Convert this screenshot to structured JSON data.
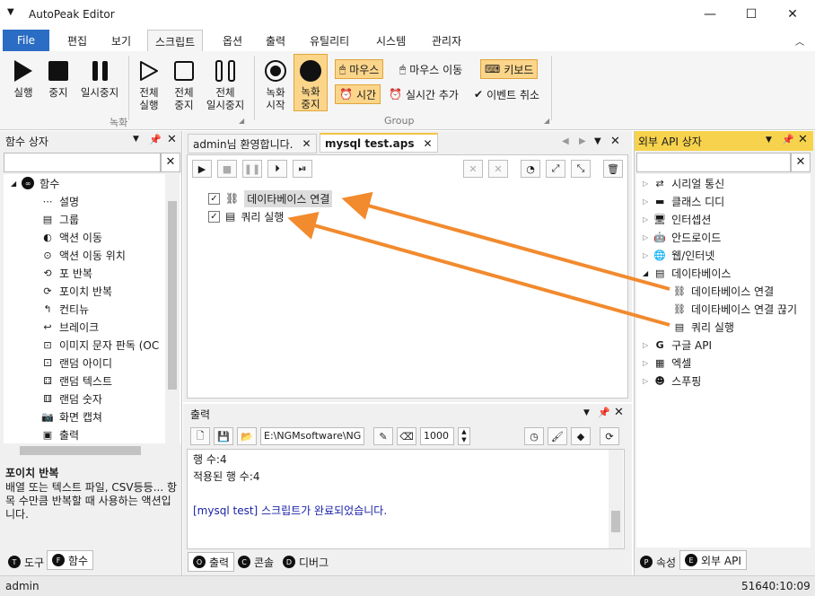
{
  "window": {
    "title": "AutoPeak Editor",
    "min": "—",
    "max": "☐",
    "close": "✕"
  },
  "menu": {
    "file": "File",
    "tabs": [
      "편집",
      "보기",
      "스크립트",
      "옵션",
      "출력",
      "유틸리티",
      "시스템",
      "관리자"
    ]
  },
  "ribbon": {
    "run": "실행",
    "stop": "중지",
    "pause": "일시중지",
    "run_all": [
      "전체",
      "실행"
    ],
    "stop_all": [
      "전체",
      "중지"
    ],
    "pause_all": [
      "전체",
      "일시중지"
    ],
    "rec_start": [
      "녹화",
      "시작"
    ],
    "rec_stop": [
      "녹화",
      "중지"
    ],
    "group_record": "녹화",
    "group_group": "Group",
    "mouse": "마우스",
    "mouse_move": "마우스 이동",
    "keyboard": "키보드",
    "time": "시간",
    "realtime_add": "실시간 추가",
    "event_cancel": "이벤트 취소"
  },
  "left": {
    "title": "함수 상자",
    "root": "함수",
    "items": [
      "설명",
      "그룹",
      "액션 이동",
      "액션 이동 위치",
      "포 반복",
      "포이치 반복",
      "컨티뉴",
      "브레이크",
      "이미지 문자 판독 (OC",
      "랜덤 아이디",
      "랜덤 텍스트",
      "랜덤 숫자",
      "화면 캡쳐",
      "출력"
    ],
    "desc_title": "포이치 반복",
    "desc_text": "배열 또는 텍스트 파일, CSV등등... 항목 수만큼 반복할 때 사용하는 액션입니다.",
    "tabs": [
      "도구",
      "함수"
    ]
  },
  "doc": {
    "tabs": [
      "admin님 환영합니다.",
      "mysql test.aps"
    ],
    "items": [
      "데이타베이스 연결",
      "쿼리 실행"
    ]
  },
  "output": {
    "title": "출력",
    "path": "E:\\NGMsoftware\\NG",
    "count": "1000",
    "lines": [
      "행 수:4",
      "적용된 행 수:4",
      "",
      "[mysql test] 스크립트가 완료되었습니다."
    ],
    "tabs": [
      "출력",
      "콘솔",
      "디버그"
    ]
  },
  "right": {
    "title": "외부 API 상자",
    "items": [
      "시리얼 통신",
      "클래스 디디",
      "인터셉션",
      "안드로이드",
      "웹/인터넷",
      "데이타베이스",
      "데이타베이스 연결",
      "데이타베이스 연결 끊기",
      "쿼리 실행",
      "구글 API",
      "엑셀",
      "스푸핑"
    ],
    "tabs": [
      "속성",
      "외부 API"
    ]
  },
  "status": {
    "user": "admin",
    "time": "51640:10:09"
  },
  "colors": {
    "accent": "#2b6cc4",
    "highlight": "#fbd58a",
    "arrow": "#f28a2e"
  }
}
